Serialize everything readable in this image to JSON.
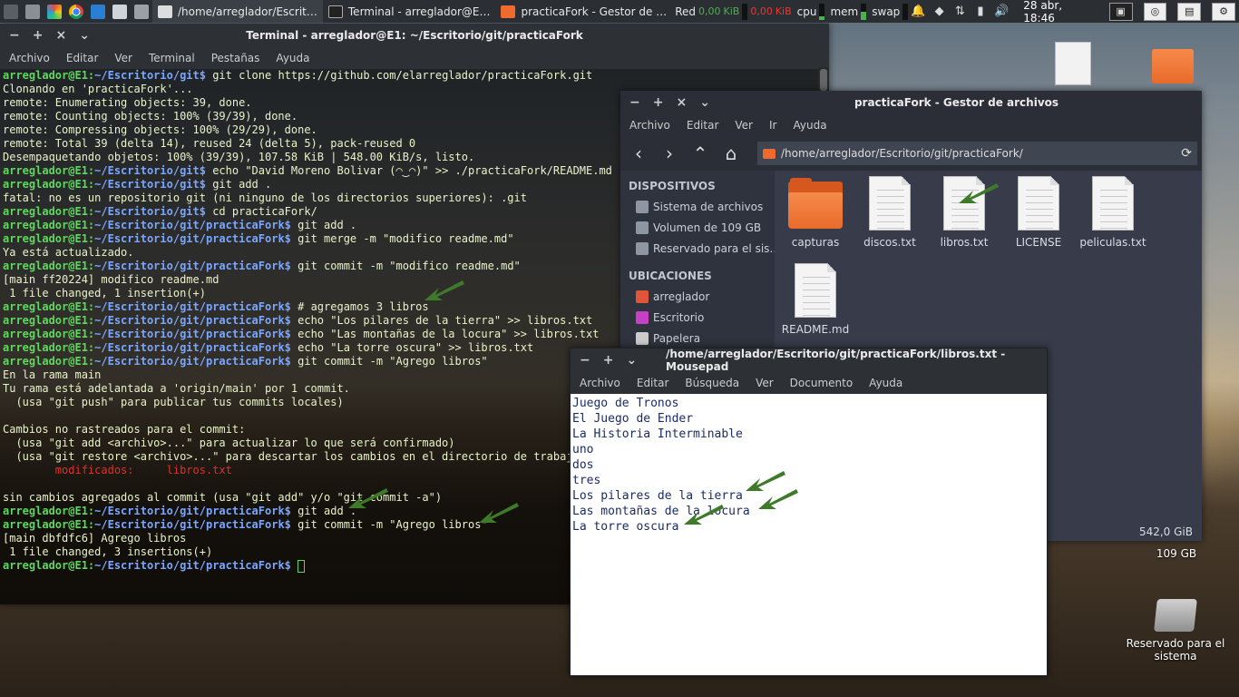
{
  "panel": {
    "tasks": [
      {
        "label": "/home/arreglador/Escrit…",
        "active": true
      },
      {
        "label": "Terminal - arreglador@E…",
        "active": false
      },
      {
        "label": "practicaFork - Gestor de …",
        "active": false
      }
    ],
    "monitors": {
      "net_label": "Red",
      "net_down": "0,00",
      "net_down_unit": "KiB",
      "net_up": "0,00",
      "net_up_unit": "KiB",
      "cpu_label": "cpu",
      "mem_label": "mem",
      "swap_label": "swap"
    },
    "clock": "28 abr, 18:46",
    "icons": [
      "files-icon",
      "terminal-icon",
      "chromium-icon",
      "writer-icon",
      "mail-icon",
      "settings-icon"
    ]
  },
  "terminal": {
    "title": "Terminal - arreglador@E1: ~/Escritorio/git/practicaFork",
    "menu": [
      "Archivo",
      "Editar",
      "Ver",
      "Terminal",
      "Pestañas",
      "Ayuda"
    ],
    "lines": [
      {
        "type": "prompt",
        "user": "arreglador@E1",
        "path": "~/Escritorio/git",
        "cmd": " git clone https://github.com/elarreglador/practicaFork.git"
      },
      {
        "type": "out",
        "text": "Clonando en 'practicaFork'..."
      },
      {
        "type": "out",
        "text": "remote: Enumerating objects: 39, done."
      },
      {
        "type": "out",
        "text": "remote: Counting objects: 100% (39/39), done."
      },
      {
        "type": "out",
        "text": "remote: Compressing objects: 100% (29/29), done."
      },
      {
        "type": "out",
        "text": "remote: Total 39 (delta 14), reused 24 (delta 5), pack-reused 0"
      },
      {
        "type": "out",
        "text": "Desempaquetando objetos: 100% (39/39), 107.58 KiB | 548.00 KiB/s, listo."
      },
      {
        "type": "prompt",
        "user": "arreglador@E1",
        "path": "~/Escritorio/git",
        "cmd": " echo \"David Moreno Bolivar (◠‿◠)\" >> ./practicaFork/README.md"
      },
      {
        "type": "prompt",
        "user": "arreglador@E1",
        "path": "~/Escritorio/git",
        "cmd": " git add ."
      },
      {
        "type": "out",
        "text": "fatal: no es un repositorio git (ni ninguno de los directorios superiores): .git"
      },
      {
        "type": "prompt",
        "user": "arreglador@E1",
        "path": "~/Escritorio/git",
        "cmd": " cd practicaFork/"
      },
      {
        "type": "prompt",
        "user": "arreglador@E1",
        "path": "~/Escritorio/git/practicaFork",
        "cmd": " git add ."
      },
      {
        "type": "prompt",
        "user": "arreglador@E1",
        "path": "~/Escritorio/git/practicaFork",
        "cmd": " git merge -m \"modifico readme.md\""
      },
      {
        "type": "out",
        "text": "Ya está actualizado."
      },
      {
        "type": "prompt",
        "user": "arreglador@E1",
        "path": "~/Escritorio/git/practicaFork",
        "cmd": " git commit -m \"modifico readme.md\""
      },
      {
        "type": "out",
        "text": "[main ff20224] modifico readme.md"
      },
      {
        "type": "out",
        "text": " 1 file changed, 1 insertion(+)"
      },
      {
        "type": "prompt",
        "user": "arreglador@E1",
        "path": "~/Escritorio/git/practicaFork",
        "cmd": " # agregamos 3 libros"
      },
      {
        "type": "prompt",
        "user": "arreglador@E1",
        "path": "~/Escritorio/git/practicaFork",
        "cmd": " echo \"Los pilares de la tierra\" >> libros.txt"
      },
      {
        "type": "prompt",
        "user": "arreglador@E1",
        "path": "~/Escritorio/git/practicaFork",
        "cmd": " echo \"Las montañas de la locura\" >> libros.txt"
      },
      {
        "type": "prompt",
        "user": "arreglador@E1",
        "path": "~/Escritorio/git/practicaFork",
        "cmd": " echo \"La torre oscura\" >> libros.txt"
      },
      {
        "type": "prompt",
        "user": "arreglador@E1",
        "path": "~/Escritorio/git/practicaFork",
        "cmd": " git commit -m \"Agrego libros\""
      },
      {
        "type": "out",
        "text": "En la rama main"
      },
      {
        "type": "out",
        "text": "Tu rama está adelantada a 'origin/main' por 1 commit."
      },
      {
        "type": "out",
        "text": "  (usa \"git push\" para publicar tus commits locales)"
      },
      {
        "type": "out",
        "text": ""
      },
      {
        "type": "out",
        "text": "Cambios no rastreados para el commit:"
      },
      {
        "type": "out",
        "text": "  (usa \"git add <archivo>...\" para actualizar lo que será confirmado)"
      },
      {
        "type": "out",
        "text": "  (usa \"git restore <archivo>...\" para descartar los cambios en el directorio de trabajo)"
      },
      {
        "type": "red",
        "text": "\tmodificados:     libros.txt"
      },
      {
        "type": "out",
        "text": ""
      },
      {
        "type": "out",
        "text": "sin cambios agregados al commit (usa \"git add\" y/o \"git commit -a\")"
      },
      {
        "type": "prompt",
        "user": "arreglador@E1",
        "path": "~/Escritorio/git/practicaFork",
        "cmd": " git add ."
      },
      {
        "type": "prompt",
        "user": "arreglador@E1",
        "path": "~/Escritorio/git/practicaFork",
        "cmd": " git commit -m \"Agrego libros\""
      },
      {
        "type": "out",
        "text": "[main dbfdfc6] Agrego libros"
      },
      {
        "type": "out",
        "text": " 1 file changed, 3 insertions(+)"
      },
      {
        "type": "prompt",
        "user": "arreglador@E1",
        "path": "~/Escritorio/git/practicaFork",
        "cmd": " "
      }
    ]
  },
  "filemgr": {
    "title": "practicaFork - Gestor de archivos",
    "menu": [
      "Archivo",
      "Editar",
      "Ver",
      "Ir",
      "Ayuda"
    ],
    "path": "/home/arreglador/Escritorio/git/practicaFork/",
    "devices_heading": "DISPOSITIVOS",
    "devices": [
      "Sistema de archivos",
      "Volumen de 109 GB",
      "Reservado para el sis…"
    ],
    "places_heading": "UBICACIONES",
    "places": [
      "arreglador",
      "Escritorio",
      "Papelera"
    ],
    "files": [
      {
        "name": "capturas",
        "kind": "folder"
      },
      {
        "name": "discos.txt",
        "kind": "doc"
      },
      {
        "name": "libros.txt",
        "kind": "doc"
      },
      {
        "name": "LICENSE",
        "kind": "doc"
      },
      {
        "name": "peliculas.txt",
        "kind": "doc"
      },
      {
        "name": "README.md",
        "kind": "doc"
      }
    ],
    "status": "542,0 GiB"
  },
  "mousepad": {
    "title": "/home/arreglador/Escritorio/git/practicaFork/libros.txt - Mousepad",
    "menu": [
      "Archivo",
      "Editar",
      "Búsqueda",
      "Ver",
      "Documento",
      "Ayuda"
    ],
    "lines": [
      "Juego de Tronos",
      "El Juego de Ender",
      "La Historia Interminable",
      "uno",
      "dos",
      "tres",
      "Los pilares de la tierra",
      "Las montañas de la locura",
      "La torre oscura"
    ]
  },
  "desktop": {
    "drive_size": "109 GB",
    "reserved_label": "Reservado para el sistema"
  },
  "colors": {
    "prompt_user": "#5fd75f",
    "prompt_path": "#7aa6ff",
    "terminal_text": "#e9f3c9",
    "arrow": "#3f7a2a",
    "folder": "#ef6a2e"
  }
}
